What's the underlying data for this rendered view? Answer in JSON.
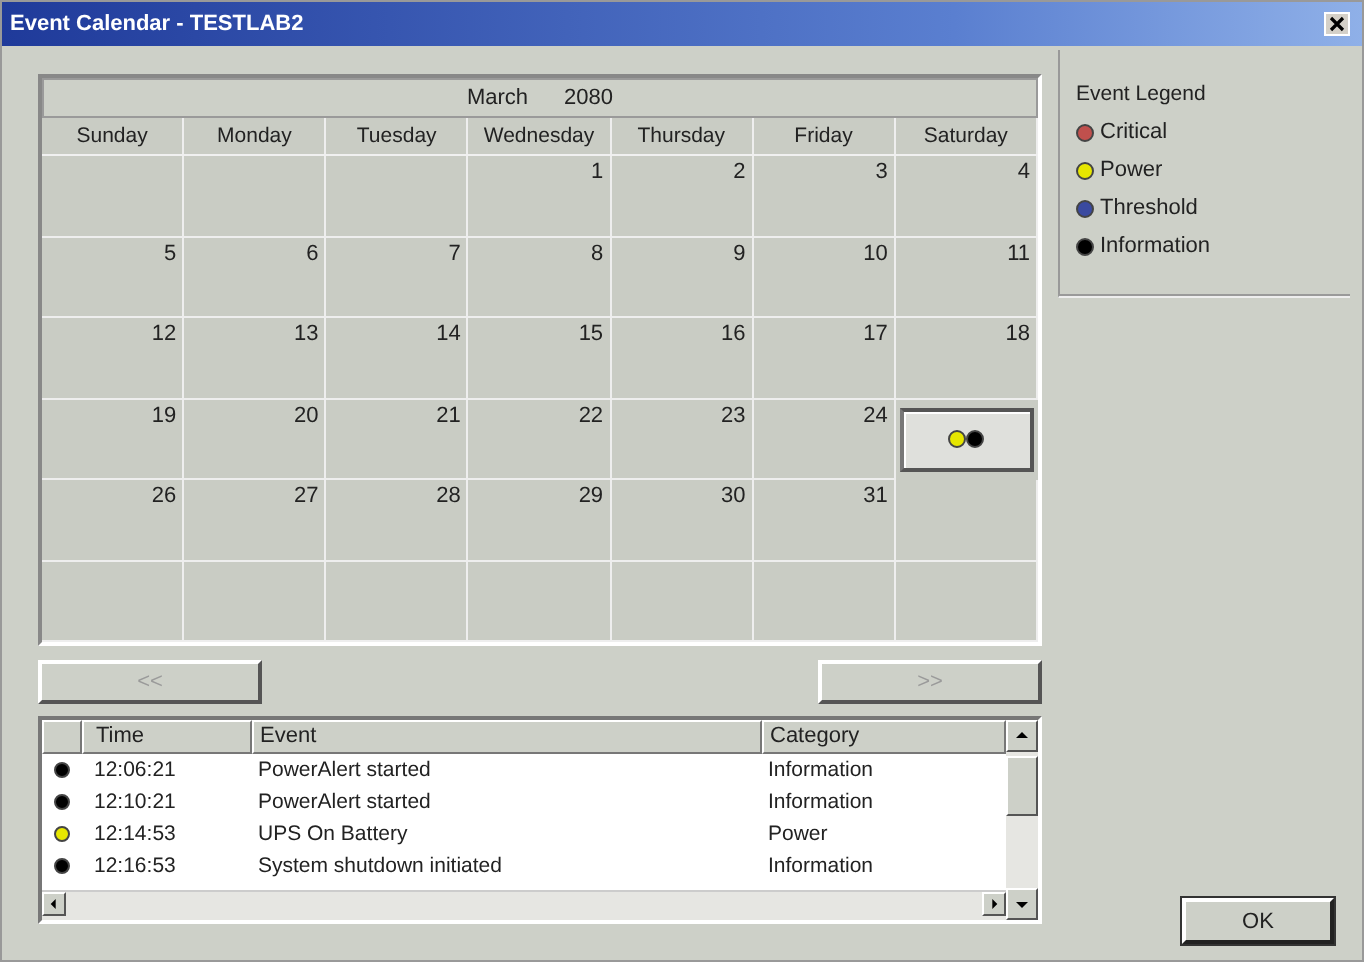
{
  "window": {
    "title": "Event Calendar - TESTLAB2"
  },
  "calendar": {
    "month": "March",
    "year": "2080",
    "weekdays": [
      "Sunday",
      "Monday",
      "Tuesday",
      "Wednesday",
      "Thursday",
      "Friday",
      "Saturday"
    ],
    "weeks": [
      [
        {
          "selected": false
        },
        {
          "selected": false
        },
        {
          "selected": false
        },
        {
          "day": "1",
          "selected": false
        },
        {
          "day": "2",
          "selected": false
        },
        {
          "day": "3",
          "selected": false
        },
        {
          "day": "4",
          "selected": false
        }
      ],
      [
        {
          "day": "5",
          "selected": false
        },
        {
          "day": "6",
          "selected": false
        },
        {
          "day": "7",
          "selected": false
        },
        {
          "day": "8",
          "selected": false
        },
        {
          "day": "9",
          "selected": false
        },
        {
          "day": "10",
          "selected": false
        },
        {
          "day": "11",
          "selected": false
        }
      ],
      [
        {
          "day": "12",
          "selected": false
        },
        {
          "day": "13",
          "selected": false
        },
        {
          "day": "14",
          "selected": false
        },
        {
          "day": "15",
          "selected": false
        },
        {
          "day": "16",
          "selected": false
        },
        {
          "day": "17",
          "selected": false
        },
        {
          "day": "18",
          "selected": false
        }
      ],
      [
        {
          "day": "19",
          "selected": false
        },
        {
          "day": "20",
          "selected": false
        },
        {
          "day": "21",
          "selected": false
        },
        {
          "day": "22",
          "selected": false
        },
        {
          "day": "23",
          "selected": false
        },
        {
          "day": "24",
          "selected": false
        },
        {
          "selected": true,
          "events": [
            {
              "color": "#e6e600"
            },
            {
              "color": "#000000"
            }
          ]
        }
      ],
      [
        {
          "day": "26",
          "selected": false
        },
        {
          "day": "27",
          "selected": false
        },
        {
          "day": "28",
          "selected": false
        },
        {
          "day": "29",
          "selected": false
        },
        {
          "day": "30",
          "selected": false
        },
        {
          "day": "31",
          "selected": false
        },
        {
          "selected": false
        }
      ],
      [
        {
          "selected": false
        },
        {
          "selected": false
        },
        {
          "selected": false
        },
        {
          "selected": false
        },
        {
          "selected": false
        },
        {
          "selected": false
        },
        {
          "selected": false
        }
      ]
    ]
  },
  "nav_buttons": [
    {
      "label": "<<",
      "disabled": true
    },
    {
      "label": ">>",
      "disabled": true
    }
  ],
  "event_list": {
    "columns": [
      "Time",
      "Event",
      "Category"
    ],
    "rows": [
      {
        "color": "#000000",
        "time": "12:06:21",
        "event": "PowerAlert started",
        "category": "Information"
      },
      {
        "color": "#000000",
        "time": "12:10:21",
        "event": "PowerAlert started",
        "category": "Information"
      },
      {
        "color": "#e6e600",
        "time": "12:14:53",
        "event": "UPS On Battery",
        "category": "Power"
      },
      {
        "color": "#000000",
        "time": "12:16:53",
        "event": "System shutdown initiated",
        "category": "Information"
      }
    ]
  },
  "legend": {
    "title": "Event Legend",
    "items": [
      {
        "color": "#c0504d",
        "label": "Critical"
      },
      {
        "color": "#e6e600",
        "label": "Power"
      },
      {
        "color": "#3a4aa0",
        "label": "Threshold"
      },
      {
        "color": "#000000",
        "label": "Information"
      }
    ]
  },
  "ok_button": {
    "label": "OK"
  }
}
